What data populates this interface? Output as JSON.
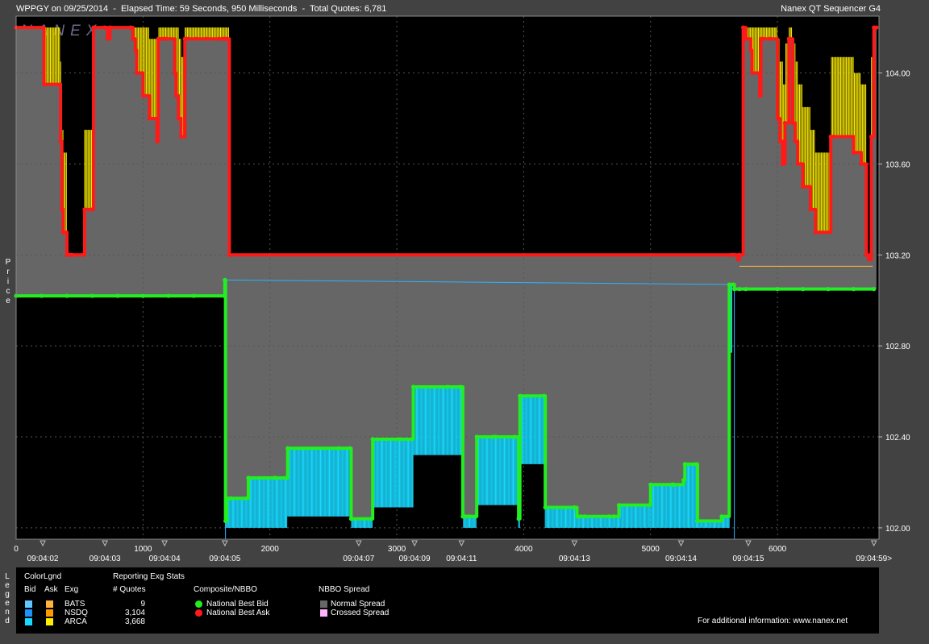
{
  "header": {
    "left": "WPPGY on 09/25/2014  -  Elapsed Time: 59 Seconds, 950 Milliseconds  -  Total Quotes: 6,781",
    "right": "Nanex QT Sequencer G4"
  },
  "watermark": "NANEX",
  "side_labels": {
    "price": "Price",
    "legend": "Legend"
  },
  "colors": {
    "plot_bg": "#000000",
    "spread": "#666666",
    "bid": "#22ee22",
    "ask": "#ff1a1a",
    "bid_fill": "#19d9ff",
    "ask_fill": "#ffee00",
    "grid": "#555555",
    "nbbo_line": "#2bb3ff"
  },
  "chart_data": {
    "type": "line",
    "title": "",
    "xlabel": "",
    "ylabel": "Price",
    "xlim": [
      0,
      6800
    ],
    "ylim": [
      101.95,
      104.25
    ],
    "grid": true,
    "y_ticks": [
      "102.00",
      "102.40",
      "102.80",
      "103.20",
      "103.60",
      "104.00"
    ],
    "y_tick_values": [
      102.0,
      102.4,
      102.8,
      103.2,
      103.6,
      104.0
    ],
    "x_ticks": [
      "0",
      "1000",
      "2000",
      "3000",
      "4000",
      "5000",
      "6000"
    ],
    "x_tick_values": [
      0,
      1000,
      2000,
      3000,
      4000,
      5000,
      6000
    ],
    "time_ticks": [
      {
        "label": "09:04:02",
        "x": 210
      },
      {
        "label": "09:04:03",
        "x": 700
      },
      {
        "label": "09:04:04",
        "x": 1170
      },
      {
        "label": "09:04:05",
        "x": 1645
      },
      {
        "label": "09:04:07",
        "x": 2700
      },
      {
        "label": "09:04:09",
        "x": 3140
      },
      {
        "label": "09:04:11",
        "x": 3510
      },
      {
        "label": "09:04:13",
        "x": 4400
      },
      {
        "label": "09:04:14",
        "x": 5240
      },
      {
        "label": "09:04:15",
        "x": 5770
      },
      {
        "label": "09:04:59>",
        "x": 6760
      }
    ],
    "series": [
      {
        "name": "National Best Ask",
        "x": [
          0,
          210,
          220,
          350,
          360,
          370,
          400,
          420,
          440,
          530,
          540,
          600,
          610,
          700,
          720,
          740,
          900,
          920,
          940,
          950,
          1000,
          1050,
          1110,
          1120,
          1150,
          1170,
          1180,
          1250,
          1260,
          1280,
          1300,
          1330,
          1340,
          1360,
          1420,
          1500,
          1600,
          1630,
          1640,
          1655,
          1660,
          1680,
          5640,
          5660,
          5690,
          5700,
          5730,
          5750,
          5790,
          5800,
          5860,
          5870,
          5890,
          5940,
          6000,
          6020,
          6040,
          6060,
          6090,
          6100,
          6120,
          6140,
          6160,
          6200,
          6260,
          6300,
          6420,
          6440,
          6600,
          6660,
          6700,
          6720,
          6740,
          6760,
          6780
        ],
        "y": [
          104.2,
          104.2,
          103.95,
          103.7,
          103.4,
          103.3,
          103.2,
          103.2,
          103.2,
          103.2,
          103.4,
          103.4,
          104.2,
          104.2,
          104.15,
          104.2,
          104.2,
          104.15,
          104.1,
          104.0,
          103.9,
          103.8,
          103.7,
          104.15,
          104.15,
          104.15,
          104.15,
          104.0,
          103.9,
          103.8,
          103.72,
          104.15,
          104.15,
          104.15,
          104.15,
          104.15,
          104.15,
          104.15,
          104.15,
          104.15,
          104.15,
          103.2,
          103.2,
          103.2,
          103.18,
          103.2,
          104.2,
          104.15,
          104.1,
          104.0,
          103.9,
          104.15,
          104.15,
          104.15,
          103.8,
          103.7,
          103.6,
          103.78,
          104.15,
          104.15,
          103.78,
          103.7,
          103.6,
          103.5,
          103.4,
          103.3,
          103.72,
          103.72,
          103.65,
          103.6,
          103.2,
          103.18,
          103.72,
          104.2,
          104.2
        ]
      },
      {
        "name": "National Best Bid",
        "x": [
          0,
          200,
          400,
          600,
          800,
          1000,
          1200,
          1400,
          1640,
          1645,
          1650,
          1660,
          1690,
          1820,
          1830,
          2040,
          2130,
          2140,
          2540,
          2630,
          2640,
          2800,
          2810,
          3020,
          3120,
          3130,
          3400,
          3500,
          3520,
          3540,
          3570,
          3620,
          3630,
          3760,
          3780,
          3930,
          3960,
          3970,
          4160,
          4170,
          4400,
          4420,
          4450,
          4480,
          4670,
          4710,
          4750,
          4990,
          5000,
          5170,
          5180,
          5260,
          5270,
          5360,
          5370,
          5560,
          5620,
          5650,
          5660,
          5700,
          5750,
          6000,
          6200,
          6400,
          6600,
          6760
        ],
        "y": [
          103.02,
          103.02,
          103.02,
          103.02,
          103.02,
          103.02,
          103.02,
          103.02,
          103.02,
          103.09,
          102.03,
          102.13,
          102.13,
          102.13,
          102.22,
          102.22,
          102.22,
          102.35,
          102.35,
          102.35,
          102.04,
          102.04,
          102.39,
          102.39,
          102.39,
          102.62,
          102.62,
          102.62,
          102.05,
          102.05,
          102.05,
          102.05,
          102.4,
          102.4,
          102.4,
          102.4,
          102.04,
          102.58,
          102.58,
          102.09,
          102.09,
          102.05,
          102.05,
          102.05,
          102.05,
          102.05,
          102.1,
          102.1,
          102.19,
          102.19,
          102.19,
          102.21,
          102.28,
          102.28,
          102.03,
          102.05,
          103.07,
          103.07,
          103.05,
          103.05,
          103.05,
          103.05,
          103.05,
          103.05,
          103.05,
          103.05
        ]
      }
    ]
  },
  "legend": {
    "color_legend_title": "ColorLgnd",
    "col_bid": "Bid",
    "col_ask": "Ask",
    "col_exg": "Exg",
    "stats_title": "Reporting Exg Stats",
    "stats_col": "# Quotes",
    "exchanges": [
      {
        "name": "BATS",
        "quotes": "9",
        "bid_color": "#5ec8ff",
        "ask_color": "#ffb23f"
      },
      {
        "name": "NSDQ",
        "quotes": "3,104",
        "bid_color": "#1e90ff",
        "ask_color": "#ff9900"
      },
      {
        "name": "ARCA",
        "quotes": "3,668",
        "bid_color": "#19d9ff",
        "ask_color": "#ffee00"
      }
    ],
    "composite_title": "Composite/NBBO",
    "nbb": "National Best Bid",
    "nbo": "National Best Ask",
    "spread_title": "NBBO Spread",
    "normal_spread": "Normal Spread",
    "crossed_spread": "Crossed Spread",
    "normal_spread_color": "#666666",
    "crossed_spread_color": "#ffb3ff",
    "info": "For additional information: www.nanex.net"
  }
}
